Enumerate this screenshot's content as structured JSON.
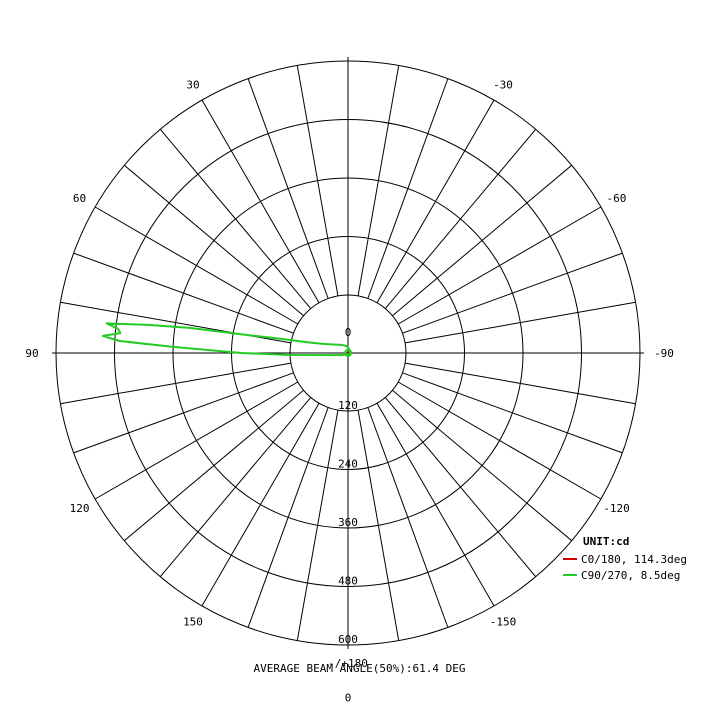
{
  "chart_data": {
    "type": "polar",
    "radial_unit_label": "UNIT:cd",
    "radial_ticks": [
      "0",
      "120",
      "240",
      "360",
      "480",
      "600",
      "0"
    ],
    "rlim": [
      0,
      600
    ],
    "angle_labels": [
      {
        "text": "-/+180",
        "angle": 180
      },
      {
        "text": "150",
        "angle": 150
      },
      {
        "text": "120",
        "angle": 120
      },
      {
        "text": "90",
        "angle": 90
      },
      {
        "text": "60",
        "angle": 60
      },
      {
        "text": "30",
        "angle": 30
      },
      {
        "text": "-30",
        "angle": -30
      },
      {
        "text": "-60",
        "angle": -60
      },
      {
        "text": "-90",
        "angle": -90
      },
      {
        "text": "-120",
        "angle": -120
      },
      {
        "text": "-150",
        "angle": -150
      }
    ],
    "spoke_step_deg": 10,
    "grid": true,
    "legend_position": "bottom-right",
    "series": [
      {
        "name": "C0/180, 114.3deg",
        "color": "#cc0000",
        "points": [
          [
            -90,
            0
          ],
          [
            0,
            2
          ],
          [
            90,
            0
          ]
        ]
      },
      {
        "name": "C90/270, 8.5deg",
        "color": "#22cc22",
        "points": [
          [
            -84,
            475
          ],
          [
            -83,
            500
          ],
          [
            -82,
            415
          ],
          [
            -81,
            330
          ],
          [
            -80,
            220
          ],
          [
            -78,
            140
          ],
          [
            -75,
            85
          ],
          [
            -70,
            55
          ],
          [
            -60,
            35
          ],
          [
            -40,
            22
          ],
          [
            -20,
            16
          ],
          [
            0,
            12
          ],
          [
            20,
            8
          ],
          [
            40,
            6
          ],
          [
            60,
            6
          ],
          [
            80,
            7
          ],
          [
            90,
            6
          ],
          [
            100,
            5
          ],
          [
            120,
            4
          ],
          [
            150,
            3
          ],
          [
            180,
            3
          ],
          [
            -150,
            4
          ],
          [
            -120,
            8
          ],
          [
            -100,
            25
          ],
          [
            -92,
            120
          ],
          [
            -90,
            220
          ],
          [
            -88,
            360
          ],
          [
            -87,
            470
          ],
          [
            -86,
            505
          ],
          [
            -85,
            470
          ],
          [
            -84,
            475
          ]
        ]
      }
    ],
    "footer": "AVERAGE BEAM ANGLE(50%):61.4 DEG"
  }
}
